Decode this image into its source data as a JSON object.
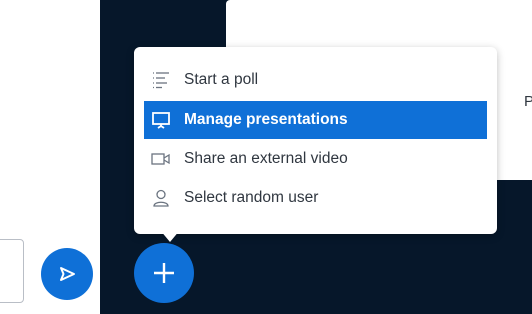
{
  "menu": {
    "items": [
      {
        "label": "Start a poll",
        "icon": "poll-icon",
        "active": false
      },
      {
        "label": "Manage presentations",
        "icon": "presentation-icon",
        "active": true
      },
      {
        "label": "Share an external video",
        "icon": "video-camera-icon",
        "active": false
      },
      {
        "label": "Select random user",
        "icon": "user-icon",
        "active": false
      }
    ]
  },
  "stage": {
    "card_partial_text": "P"
  },
  "colors": {
    "accent": "#0f70d7",
    "stage_bg": "#06172a",
    "menu_text": "#303740"
  },
  "icons": {
    "send": "send-icon",
    "plus": "plus-icon"
  }
}
